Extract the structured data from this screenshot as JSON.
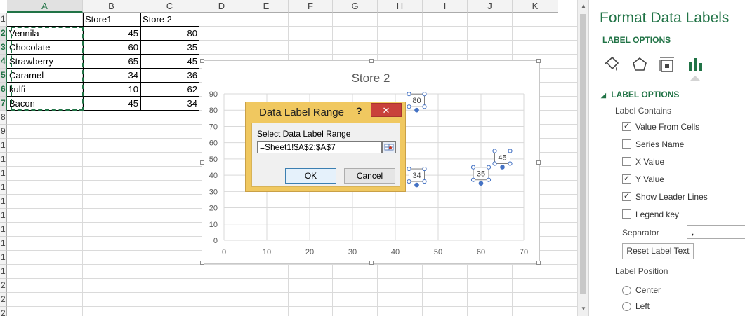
{
  "columns": [
    "A",
    "B",
    "C",
    "D",
    "E",
    "F",
    "G",
    "H",
    "I",
    "J",
    "K"
  ],
  "rows": [
    "1",
    "2",
    "3",
    "4",
    "5",
    "6",
    "7",
    "8",
    "9",
    "10",
    "11",
    "12",
    "13",
    "14",
    "15",
    "16",
    "17",
    "18",
    "19",
    "20",
    "21",
    "22"
  ],
  "table": {
    "headers": [
      "",
      "Store1",
      "Store 2"
    ],
    "data": [
      [
        "Vennila",
        "45",
        "80"
      ],
      [
        "Chocolate",
        "60",
        "35"
      ],
      [
        "Strawberry",
        "65",
        "45"
      ],
      [
        "Caramel",
        "34",
        "36"
      ],
      [
        "kulfi",
        "10",
        "62"
      ],
      [
        "Bacon",
        "45",
        "34"
      ]
    ]
  },
  "chart_data": {
    "type": "scatter",
    "title": "Store 2",
    "xlim": [
      0,
      70
    ],
    "ylim": [
      0,
      90
    ],
    "xticks": [
      "0",
      "10",
      "20",
      "30",
      "40",
      "50",
      "60",
      "70"
    ],
    "yticks": [
      "0",
      "10",
      "20",
      "30",
      "40",
      "50",
      "60",
      "70",
      "80",
      "90"
    ],
    "grid": true,
    "series": [
      {
        "x": [
          45,
          60,
          65,
          34,
          10,
          45
        ],
        "y": [
          80,
          35,
          45,
          36,
          62,
          34
        ]
      }
    ],
    "visible_labels": [
      {
        "x": 45,
        "y": 80,
        "text": "80"
      },
      {
        "x": 60,
        "y": 35,
        "text": "35"
      },
      {
        "x": 65,
        "y": 45,
        "text": "45"
      },
      {
        "x": 45,
        "y": 34,
        "text": "34"
      }
    ]
  },
  "dialog": {
    "title": "Data Label Range",
    "help": "?",
    "close": "✕",
    "prompt": "Select Data Label Range",
    "value": "=Sheet1!$A$2:$A$7",
    "ok": "OK",
    "cancel": "Cancel"
  },
  "panel": {
    "title": "Format Data Labels",
    "subtitle": "LABEL OPTIONS",
    "icons": [
      "fill-line-icon",
      "effects-icon",
      "size-properties-icon",
      "label-options-icon"
    ],
    "section": "LABEL OPTIONS",
    "contains_label": "Label Contains",
    "options": [
      {
        "label": "Value From Cells",
        "checked": true
      },
      {
        "label": "Series Name",
        "checked": false
      },
      {
        "label": "X Value",
        "checked": false
      },
      {
        "label": "Y Value",
        "checked": true
      },
      {
        "label": "Show Leader Lines",
        "checked": true
      },
      {
        "label": "Legend key",
        "checked": false
      }
    ],
    "separator_label": "Separator",
    "separator_value": ",",
    "reset_button": "Reset Label Text",
    "position_label": "Label Position",
    "positions": [
      {
        "label": "Center",
        "selected": false
      },
      {
        "label": "Left",
        "selected": false
      }
    ],
    "accent": "#217346"
  }
}
